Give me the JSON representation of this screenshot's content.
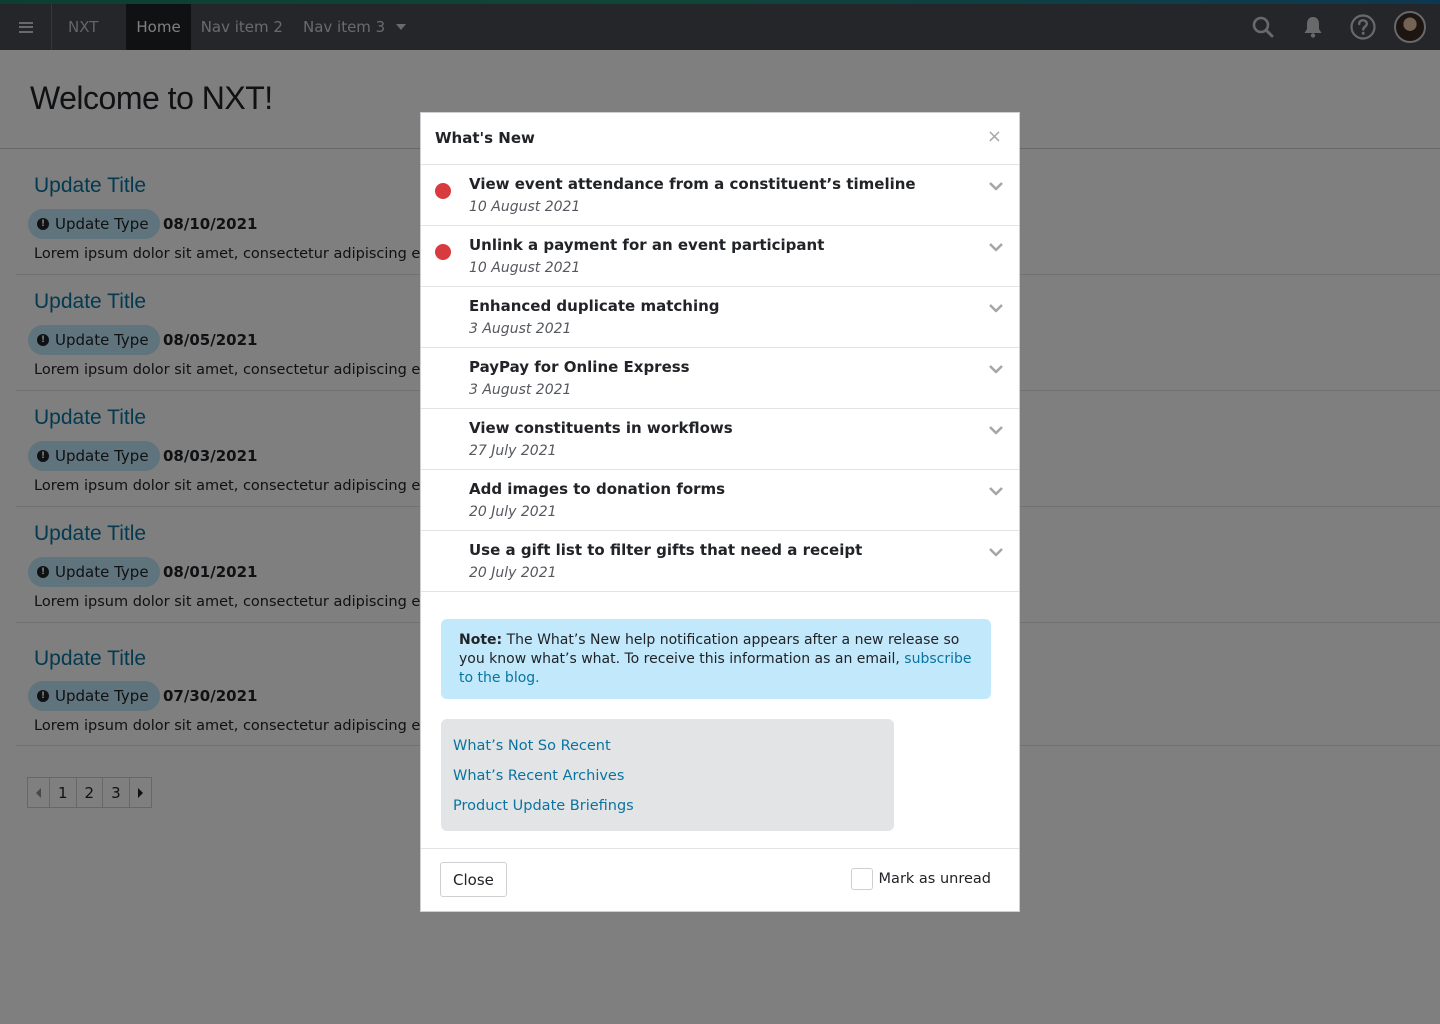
{
  "navbar": {
    "brand": "NXT",
    "items": [
      {
        "label": "Home"
      },
      {
        "label": "Nav item 2"
      },
      {
        "label": "Nav item 3"
      }
    ]
  },
  "page": {
    "title": "Welcome to NXT!",
    "updates": [
      {
        "title": "Update Title",
        "type": "Update Type",
        "date": "08/10/2021",
        "body": "Lorem ipsum dolor sit amet, consectetur adipiscing elit, s"
      },
      {
        "title": "Update Title",
        "type": "Update Type",
        "date": "08/05/2021",
        "body": "Lorem ipsum dolor sit amet, consectetur adipiscing elit, s"
      },
      {
        "title": "Update Title",
        "type": "Update Type",
        "date": "08/03/2021",
        "body": "Lorem ipsum dolor sit amet, consectetur adipiscing elit, s"
      },
      {
        "title": "Update Title",
        "type": "Update Type",
        "date": "08/01/2021",
        "body": "Lorem ipsum dolor sit amet, consectetur adipiscing elit, s"
      },
      {
        "title": "Update Title",
        "type": "Update Type",
        "date": "07/30/2021",
        "body": "Lorem ipsum dolor sit amet, consectetur adipiscing elit, s"
      }
    ],
    "pagination": {
      "pages": [
        "1",
        "2",
        "3"
      ]
    }
  },
  "modal": {
    "title": "What's New",
    "close_icon": "×",
    "items": [
      {
        "title": "View event attendance from a constituent’s timeline",
        "date": "10 August 2021",
        "unread": true
      },
      {
        "title": "Unlink a payment for an event participant",
        "date": "10 August 2021",
        "unread": true
      },
      {
        "title": "Enhanced duplicate matching",
        "date": "3 August 2021",
        "unread": false
      },
      {
        "title": "PayPay for Online Express",
        "date": "3 August 2021",
        "unread": false
      },
      {
        "title": "View constituents in workflows",
        "date": "27 July 2021",
        "unread": false
      },
      {
        "title": "Add images to donation forms",
        "date": "20 July 2021",
        "unread": false
      },
      {
        "title": "Use a gift list to filter gifts that need a receipt",
        "date": "20 July 2021",
        "unread": false
      }
    ],
    "note": {
      "label": "Note:",
      "text": " The What’s New help notification appears after a new release so you know what’s what.  To receive this information as an email, ",
      "link": "subscribe to the blog."
    },
    "links": [
      "What’s Not So Recent",
      "What’s Recent Archives",
      "Product Update Briefings"
    ],
    "footer": {
      "close_label": "Close",
      "mark_unread_label": "Mark as unread"
    }
  },
  "colors": {
    "navbar_bg": "#4a4d55",
    "link": "#0974a1",
    "unread_dot": "#d93a3f",
    "badge_bg": "#c1e8fb",
    "note_bg": "#c1e8fb"
  },
  "icons": [
    "hamburger-icon",
    "search-icon",
    "bell-icon",
    "help-icon",
    "chevron-down-icon",
    "close-icon",
    "info-icon"
  ]
}
